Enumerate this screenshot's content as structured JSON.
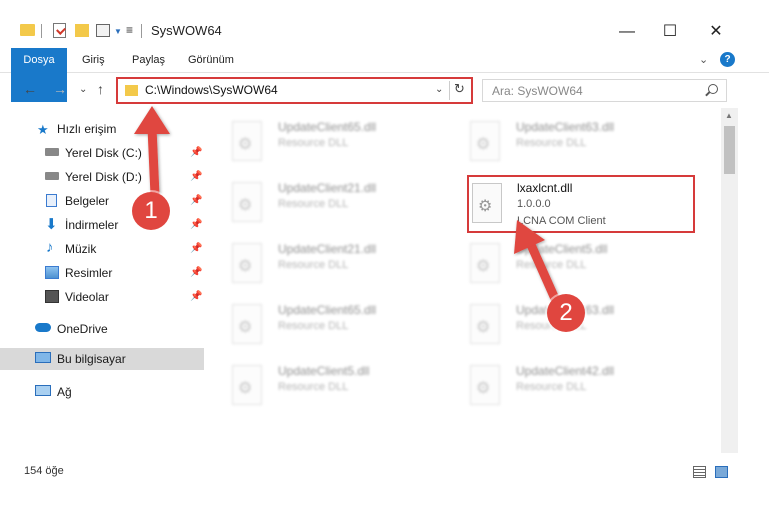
{
  "window": {
    "title": "SysWOW64",
    "minimize_glyph": "—",
    "maximize_glyph": "☐",
    "close_glyph": "✕"
  },
  "ribbon": {
    "tabs": [
      "Dosya",
      "Giriş",
      "Paylaş",
      "Görünüm"
    ],
    "help_label": "?"
  },
  "address": {
    "path": "C:\\Windows\\SysWOW64"
  },
  "search": {
    "placeholder": "Ara: SysWOW64"
  },
  "sidebar": {
    "items": [
      {
        "label": "Hızlı erişim",
        "icon": "star-icon"
      },
      {
        "label": "Yerel Disk (C:)",
        "icon": "drive-icon"
      },
      {
        "label": "Yerel Disk (D:)",
        "icon": "drive-icon"
      },
      {
        "label": "Belgeler",
        "icon": "documents-icon"
      },
      {
        "label": "İndirmeler",
        "icon": "download-icon"
      },
      {
        "label": "Müzik",
        "icon": "music-icon"
      },
      {
        "label": "Resimler",
        "icon": "pictures-icon"
      },
      {
        "label": "Videolar",
        "icon": "videos-icon"
      },
      {
        "label": "OneDrive",
        "icon": "cloud-icon"
      },
      {
        "label": "Bu bilgisayar",
        "icon": "computer-icon"
      },
      {
        "label": "Ağ",
        "icon": "network-icon"
      }
    ]
  },
  "files": [
    {
      "name": "UpdateClient65.dll",
      "type": "Resource DLL"
    },
    {
      "name": "UpdateClient63.dll",
      "type": "Resource DLL"
    },
    {
      "name": "UpdateClient21.dll",
      "type": "Resource DLL"
    },
    {
      "name": "lxaxlcnt.dll",
      "version": "1.0.0.0",
      "description": "LCNA COM Client"
    },
    {
      "name": "UpdateClient21.dll",
      "type": "Resource DLL"
    },
    {
      "name": "UpdateClient5.dll",
      "type": "Resource DLL"
    },
    {
      "name": "UpdateClient65.dll",
      "type": "Resource DLL"
    },
    {
      "name": "UpdateClient63.dll",
      "type": "Resource DLL"
    },
    {
      "name": "UpdateClient5.dll",
      "type": "Resource DLL"
    },
    {
      "name": "UpdateClient42.dll",
      "type": "Resource DLL"
    }
  ],
  "status": {
    "item_count": "154 öğe"
  },
  "annotations": {
    "badge1": "1",
    "badge2": "2",
    "accent_color": "#e0463f"
  }
}
